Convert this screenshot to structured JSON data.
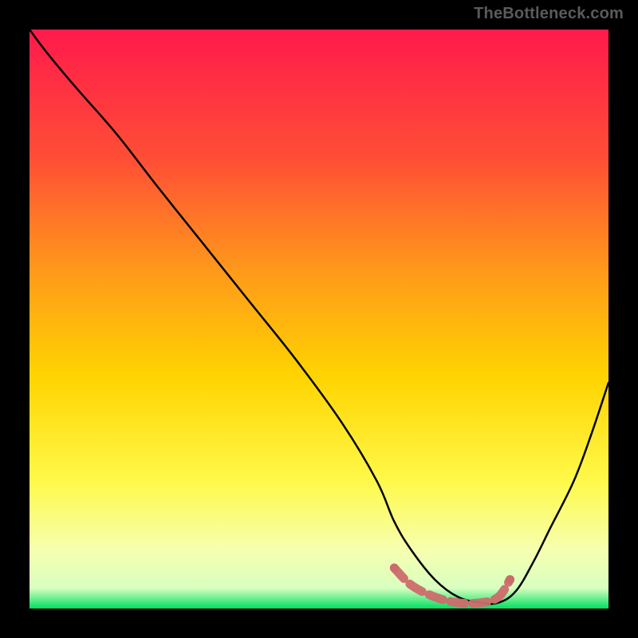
{
  "watermark": "TheBottleneck.com",
  "colors": {
    "bg_black": "#000000",
    "grad_top": "#ff1a4b",
    "grad_mid1": "#ff6a2a",
    "grad_mid2": "#ffcc00",
    "grad_mid3": "#fff94a",
    "grad_bottom": "#ffffe0",
    "grad_green": "#00e060",
    "curve": "#000000",
    "accent": "#cc6b6b"
  },
  "chart_data": {
    "type": "line",
    "title": "",
    "xlabel": "",
    "ylabel": "",
    "xlim": [
      0,
      100
    ],
    "ylim": [
      0,
      100
    ],
    "series": [
      {
        "name": "black-curve",
        "x": [
          0,
          3,
          8,
          15,
          22,
          30,
          38,
          46,
          54,
          60,
          63,
          66,
          70,
          74,
          78,
          81,
          84,
          87,
          90,
          94,
          97,
          100
        ],
        "y": [
          100,
          96,
          90,
          82,
          73,
          63,
          53,
          43,
          32,
          22,
          15,
          10,
          5,
          2,
          1,
          1,
          3,
          8,
          14,
          22,
          30,
          39
        ]
      },
      {
        "name": "accent-band",
        "x": [
          63,
          66,
          70,
          74,
          78,
          81,
          83
        ],
        "y": [
          7,
          4,
          2,
          1,
          1,
          2,
          5
        ]
      }
    ],
    "gradient_stops": [
      {
        "offset": 0.0,
        "color": "#ff1a4b"
      },
      {
        "offset": 0.22,
        "color": "#ff4d36"
      },
      {
        "offset": 0.42,
        "color": "#ff9a1a"
      },
      {
        "offset": 0.6,
        "color": "#ffd400"
      },
      {
        "offset": 0.78,
        "color": "#fff94a"
      },
      {
        "offset": 0.9,
        "color": "#f6ffb0"
      },
      {
        "offset": 0.965,
        "color": "#d8ffc0"
      },
      {
        "offset": 1.0,
        "color": "#00e060"
      }
    ]
  }
}
